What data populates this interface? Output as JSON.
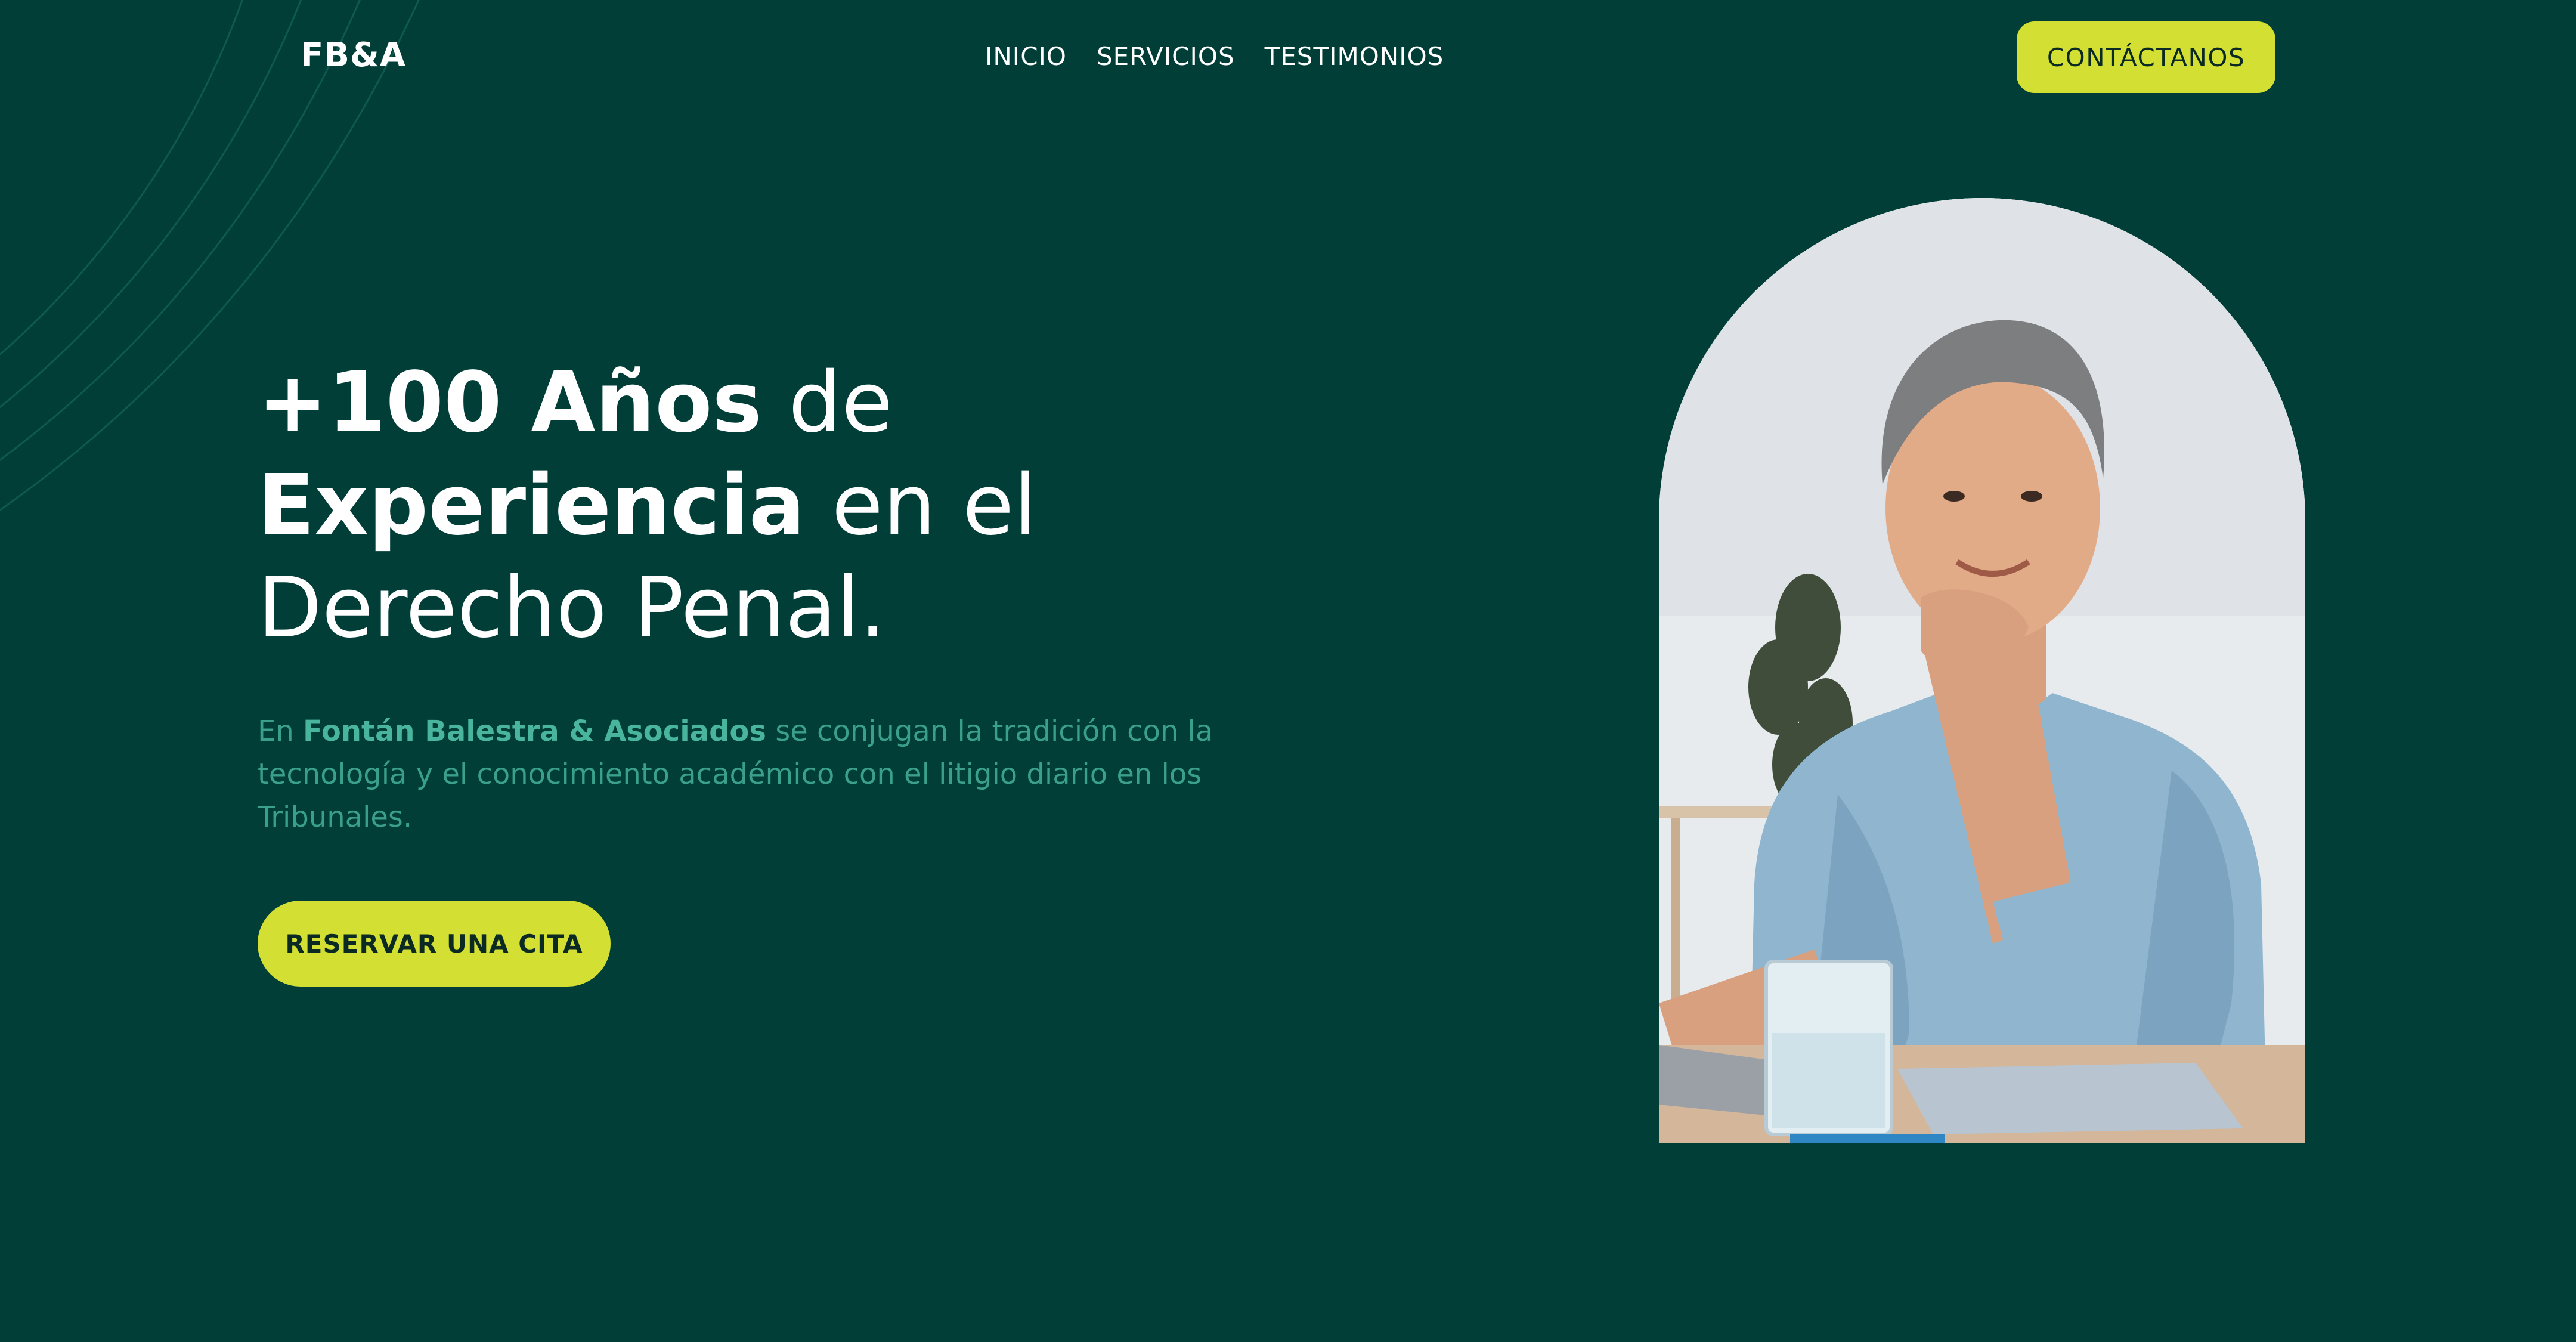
{
  "header": {
    "logo": "FB&A",
    "nav": [
      {
        "label": "INICIO"
      },
      {
        "label": "SERVICIOS"
      },
      {
        "label": "TESTIMONIOS"
      }
    ],
    "contact_label": "CONTÁCTANOS"
  },
  "hero": {
    "title": {
      "line1_bold": "+100 Años",
      "line1_rest": " de",
      "line2_bold": "Experiencia",
      "line2_rest": " en el",
      "line3": "Derecho Penal."
    },
    "description": {
      "prefix": "En ",
      "firm": "Fontán Balestra & Asociados",
      "rest": " se conjugan la tradición con la tecnología y el conocimiento académico con el litigio diario en los Tribunales."
    },
    "cta_label": "RESERVAR UNA CITA"
  },
  "colors": {
    "background": "#003e37",
    "accent": "#d3e033",
    "muted_text": "#3aa08c",
    "white": "#ffffff"
  },
  "icons": {
    "decorative_arcs": "arc-lines"
  }
}
